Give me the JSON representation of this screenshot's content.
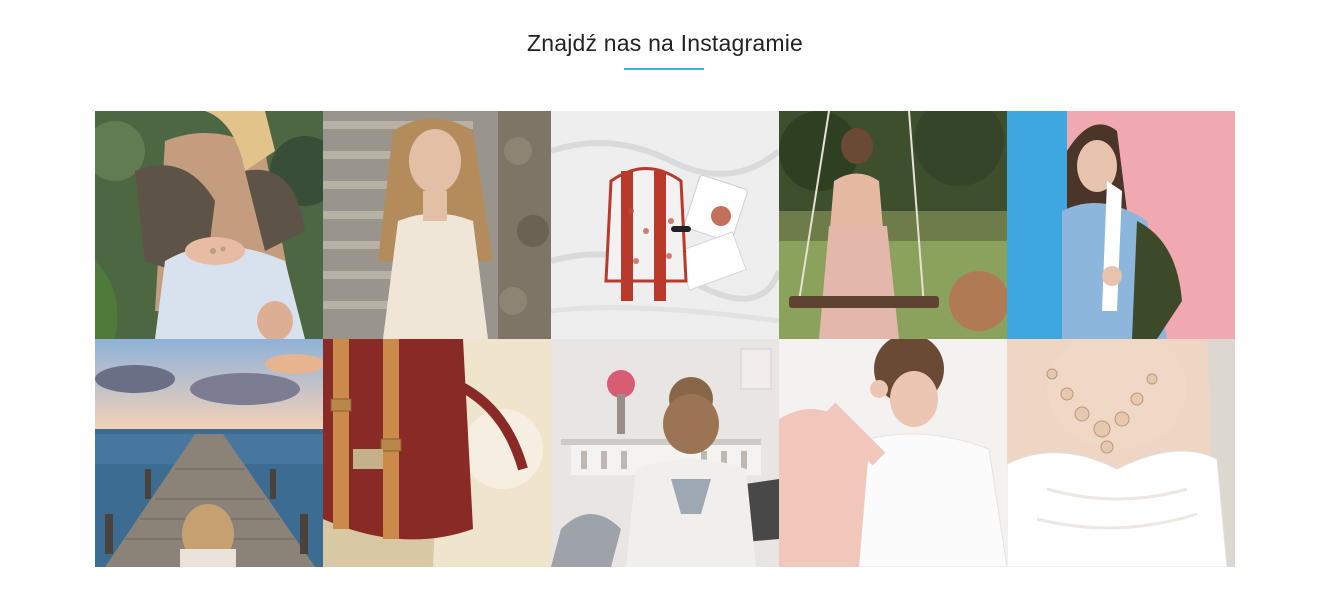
{
  "section": {
    "title": "Znajdź nas na Instagramie",
    "accent_color": "#3ab5d6"
  },
  "gallery": {
    "photos": [
      {
        "subject": "woman-sitting-with-rings"
      },
      {
        "subject": "woman-on-stone-stairs"
      },
      {
        "subject": "backpack-on-white-bed"
      },
      {
        "subject": "woman-on-swing"
      },
      {
        "subject": "woman-in-denim-jacket"
      },
      {
        "subject": "girl-on-pier-by-sea"
      },
      {
        "subject": "red-backpack-closeup"
      },
      {
        "subject": "girl-with-hair-bun"
      },
      {
        "subject": "woman-in-pink-jacket"
      },
      {
        "subject": "white-dress-with-necklace"
      }
    ]
  }
}
